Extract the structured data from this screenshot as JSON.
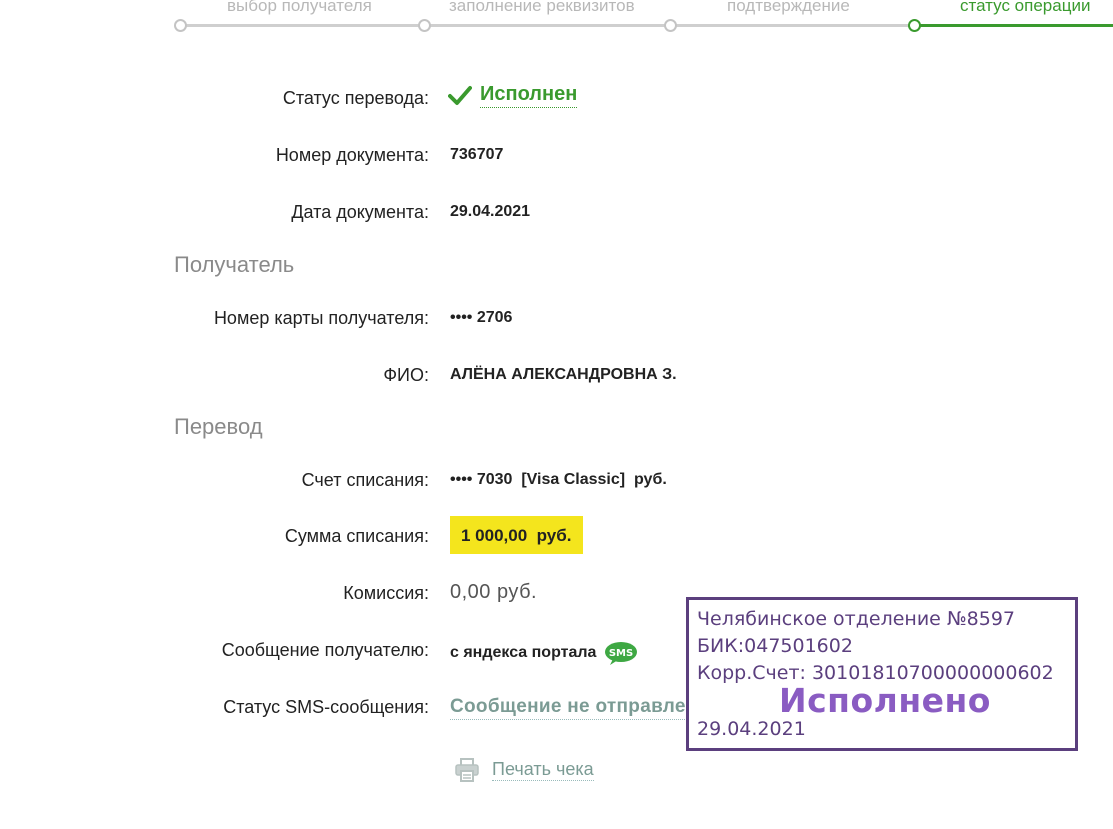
{
  "stepper": {
    "steps": [
      {
        "label": "выбор получателя",
        "active": false
      },
      {
        "label": "заполнение реквизитов",
        "active": false
      },
      {
        "label": "подтверждение",
        "active": false
      },
      {
        "label": "статус операции",
        "active": true
      }
    ],
    "colors": {
      "active": "#3a9a2e",
      "inactive": "#cfcfcf"
    }
  },
  "transfer_status": {
    "label": "Статус перевода:",
    "value": "Исполнен",
    "icon": "check-icon"
  },
  "document_number": {
    "label": "Номер документа:",
    "value": "736707"
  },
  "document_date": {
    "label": "Дата документа:",
    "value": "29.04.2021"
  },
  "recipient": {
    "section_title": "Получатель",
    "card": {
      "label": "Номер карты получателя:",
      "value": "•••• 2706"
    },
    "name": {
      "label": "ФИО:",
      "value": "АЛЁНА АЛЕКСАНДРОВНА З."
    }
  },
  "transfer": {
    "section_title": "Перевод",
    "debit_account": {
      "label": "Счет списания:",
      "value": "•••• 7030  [Visa Classic]  руб."
    },
    "amount": {
      "label": "Сумма списания:",
      "value": "1 000,00  руб.",
      "highlight": "#f4e51d"
    },
    "commission": {
      "label": "Комиссия:",
      "value": "0,00 руб."
    },
    "message": {
      "label": "Сообщение получателю:",
      "value": "с яндекса портала",
      "icon": "sms-icon",
      "icon_text": "SMS"
    },
    "sms_status": {
      "label": "Статус SMS-сообщения:",
      "value": "Сообщение не отправлено"
    }
  },
  "print": {
    "label": "Печать чека",
    "icon": "printer-icon"
  },
  "stamp": {
    "line1": "Челябинское отделение №8597",
    "line2": "БИК:047501602",
    "line3": "Корр.Счет: 30101810700000000602",
    "status": "Исполнено",
    "date": "29.04.2021",
    "color": "#5b3f7e"
  }
}
